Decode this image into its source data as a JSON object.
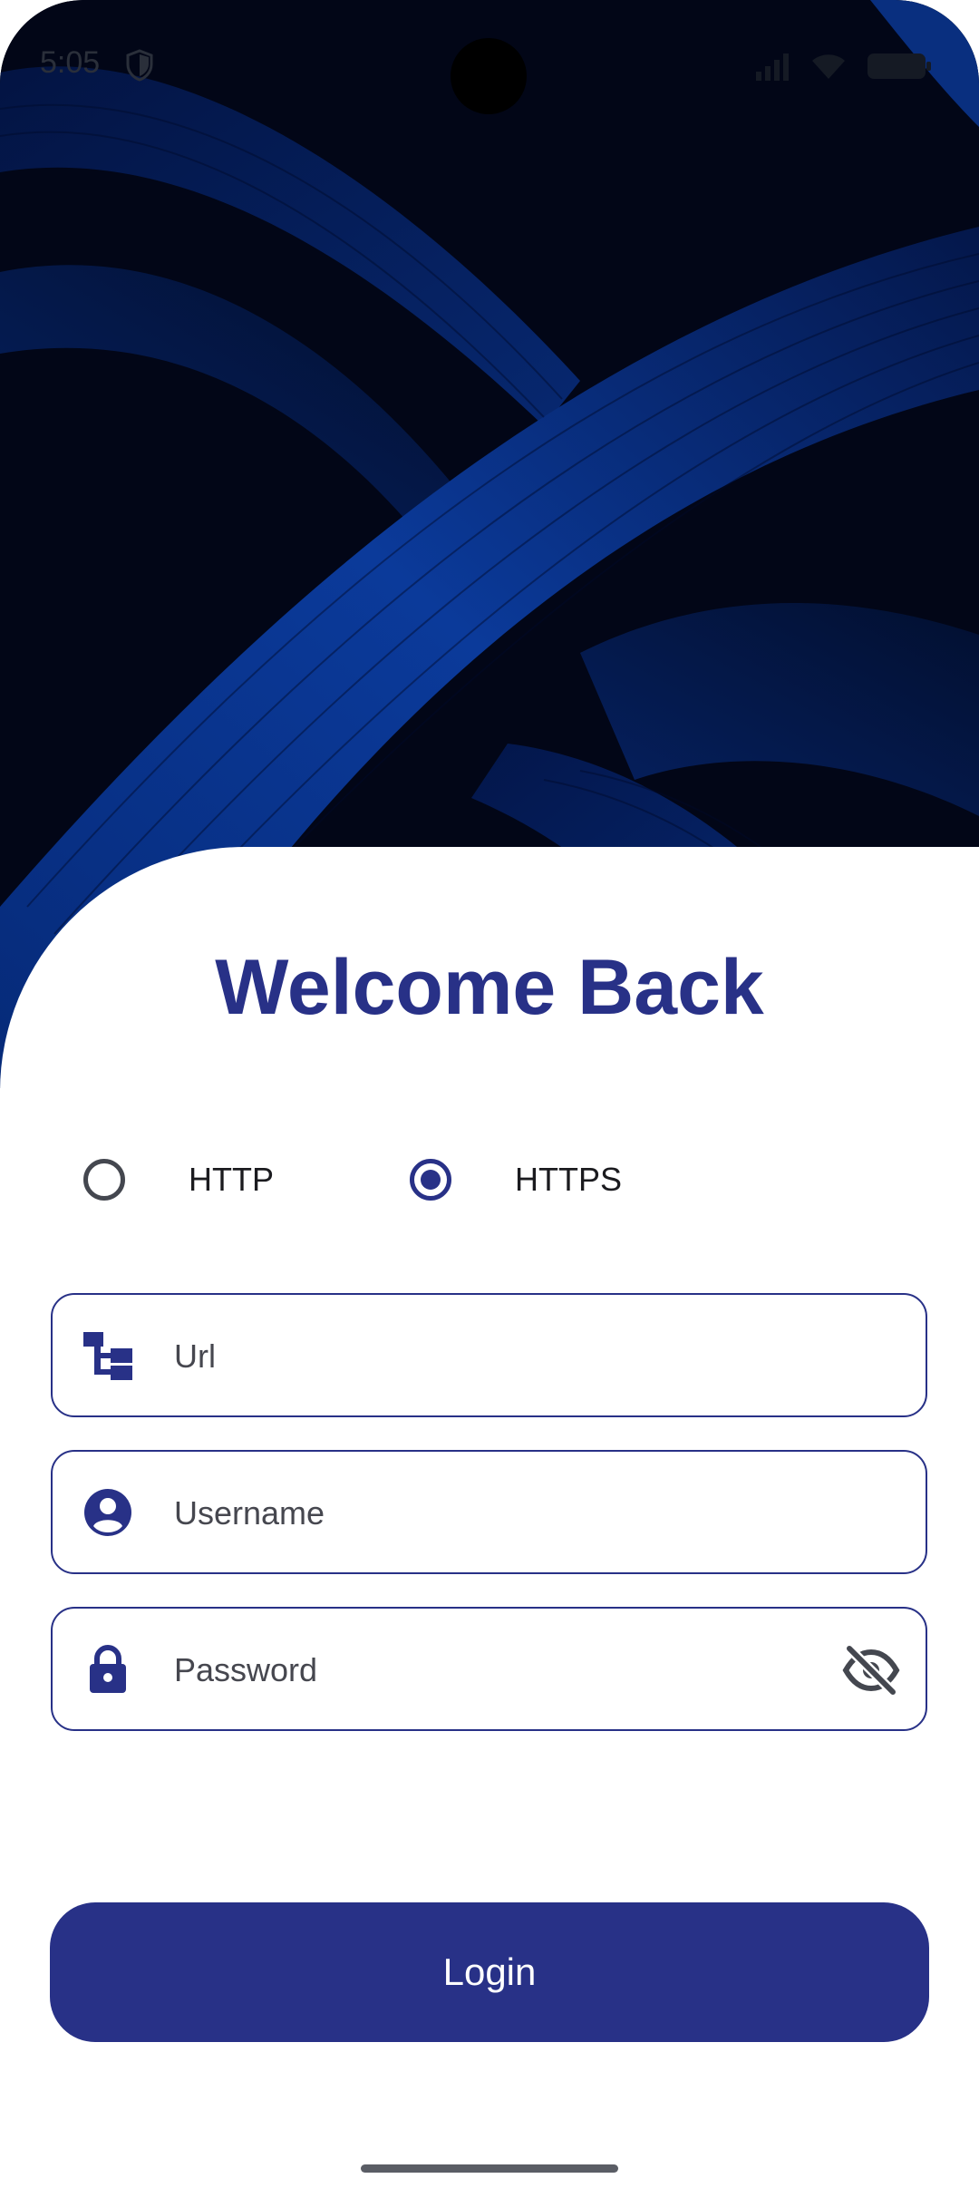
{
  "status_bar": {
    "time": "5:05",
    "icons": [
      "shield-icon",
      "signal-icon",
      "wifi-icon",
      "battery-icon"
    ]
  },
  "login": {
    "title": "Welcome Back",
    "protocol_options": [
      {
        "label": "HTTP",
        "selected": false
      },
      {
        "label": "HTTPS",
        "selected": true
      }
    ],
    "fields": {
      "url": {
        "placeholder": "Url",
        "icon": "sitemap-icon"
      },
      "username": {
        "placeholder": "Username",
        "icon": "account-circle-icon"
      },
      "password": {
        "placeholder": "Password",
        "icon": "lock-icon",
        "toggle_icon": "eye-off-icon"
      }
    },
    "button_label": "Login"
  },
  "colors": {
    "accent": "#283187",
    "hero_background": "#020617",
    "card_background": "#ffffff"
  }
}
